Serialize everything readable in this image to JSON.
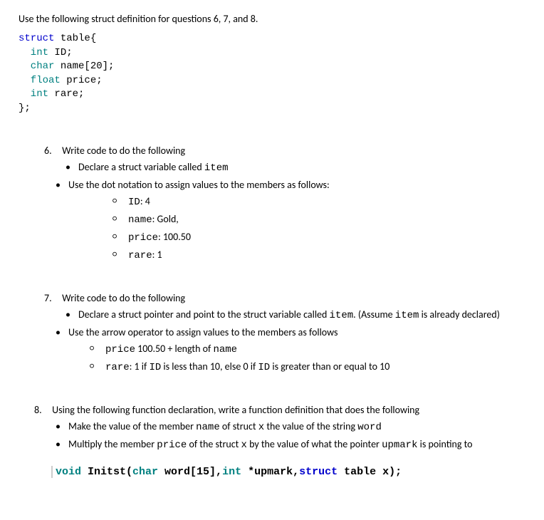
{
  "intro": "Use the following struct definition for questions 6, 7, and 8.",
  "struct_code": {
    "l1_kw1": "struct",
    "l1_ident": " table{",
    "l2_kw": "  int",
    "l2_ident": " ID;",
    "l3_kw": "  char",
    "l3_ident": " name[20];",
    "l4_kw": "  float",
    "l4_ident": " price;",
    "l5_kw": "  int",
    "l5_ident": " rare;",
    "l6": "};"
  },
  "q6": {
    "num": "6.",
    "title": "Write code to do the following",
    "b1_a": "Declare a struct variable called ",
    "b1_code": "item",
    "b2": "Use the dot notation to assign values to the members as follows:",
    "s1_code": "ID",
    "s1_rest": ": 4",
    "s2_code": "name",
    "s2_rest": ": Gold,",
    "s3_code": "price",
    "s3_rest": ": 100.50",
    "s4_code": "rare",
    "s4_rest": ": 1"
  },
  "q7": {
    "num": "7.",
    "title": "Write code to do the following",
    "b1_a": "Declare a struct pointer and point to the struct variable called ",
    "b1_code": "item",
    "b1_b": ". (Assume ",
    "b1_code2": "item",
    "b1_c": " is already declared)",
    "b2": "Use the arrow operator to assign values to the members as follows",
    "s1_code": "price",
    "s1_rest": " 100.50 + length of ",
    "s1_code2": "name",
    "s2_code": "rare",
    "s2_a": ": 1 if ",
    "s2_code2": "ID",
    "s2_b": " is less than 10, else 0 if ",
    "s2_code3": "ID",
    "s2_c": " is greater than or equal to 10"
  },
  "q8": {
    "num": "8.",
    "title": "Using the following function declaration, write a function definition that does the following",
    "b1_a": "Make the value of the member ",
    "b1_code": "name",
    "b1_b": " of struct ",
    "b1_code2": "x",
    "b1_c": " the value of the string ",
    "b1_code3": "word",
    "b2_a": "Multiply the member ",
    "b2_code": "price",
    "b2_b": " of the struct ",
    "b2_code2": "x",
    "b2_c": " by the value of what the pointer ",
    "b2_code3": "upmark",
    "b2_d": " is pointing to",
    "sig": {
      "void": "void",
      "fn": " Initst(",
      "char": "char",
      "p1": " word[15],",
      "int": "int",
      "p2": " *upmark,",
      "struct": "struct",
      "p3": " table x);"
    }
  }
}
